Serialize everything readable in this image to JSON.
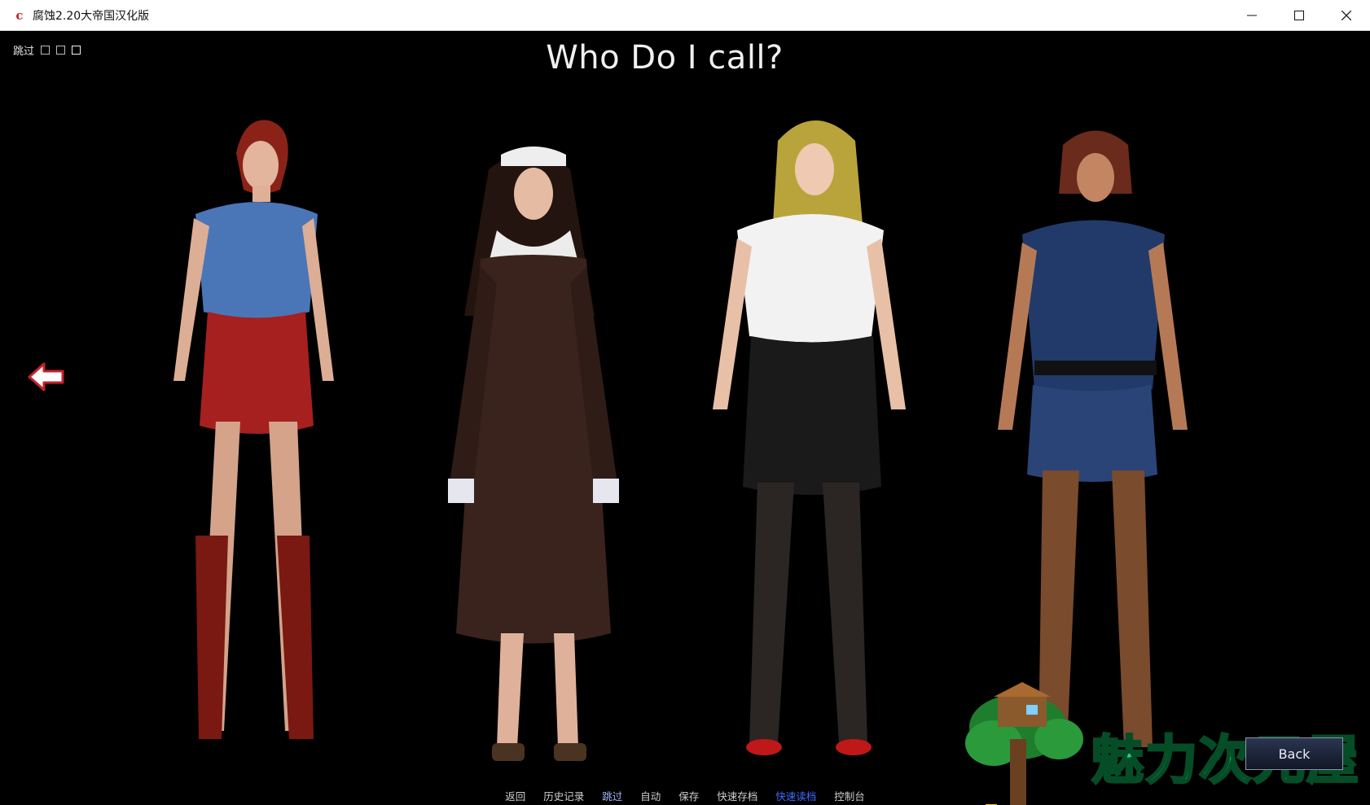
{
  "window": {
    "title": "腐蚀2.20大帝国汉化版",
    "icon": "app-c-icon",
    "controls": [
      "minimize-icon",
      "maximize-icon",
      "close-icon"
    ]
  },
  "game": {
    "skip_label": "跳过",
    "heading": "Who Do I call?",
    "characters": [
      {
        "outfit": "red-skirt-denim-top",
        "accent": "#a5201f"
      },
      {
        "outfit": "nun-habit",
        "accent": "#3a231d"
      },
      {
        "outfit": "office-blouse-black-skirt",
        "accent": "#1a1a1a"
      },
      {
        "outfit": "police-uniform",
        "accent": "#223a6a"
      }
    ],
    "quick_menu": [
      "返回",
      "历史记录",
      "跳过",
      "自动",
      "保存",
      "快速存档",
      "快速读档",
      "控制台"
    ],
    "back_label": "Back",
    "watermark_text": "魅力次元屋"
  },
  "colors": {
    "background": "#000000",
    "watermark_green": "#1fd178",
    "arrow_red": "#c8202a"
  }
}
